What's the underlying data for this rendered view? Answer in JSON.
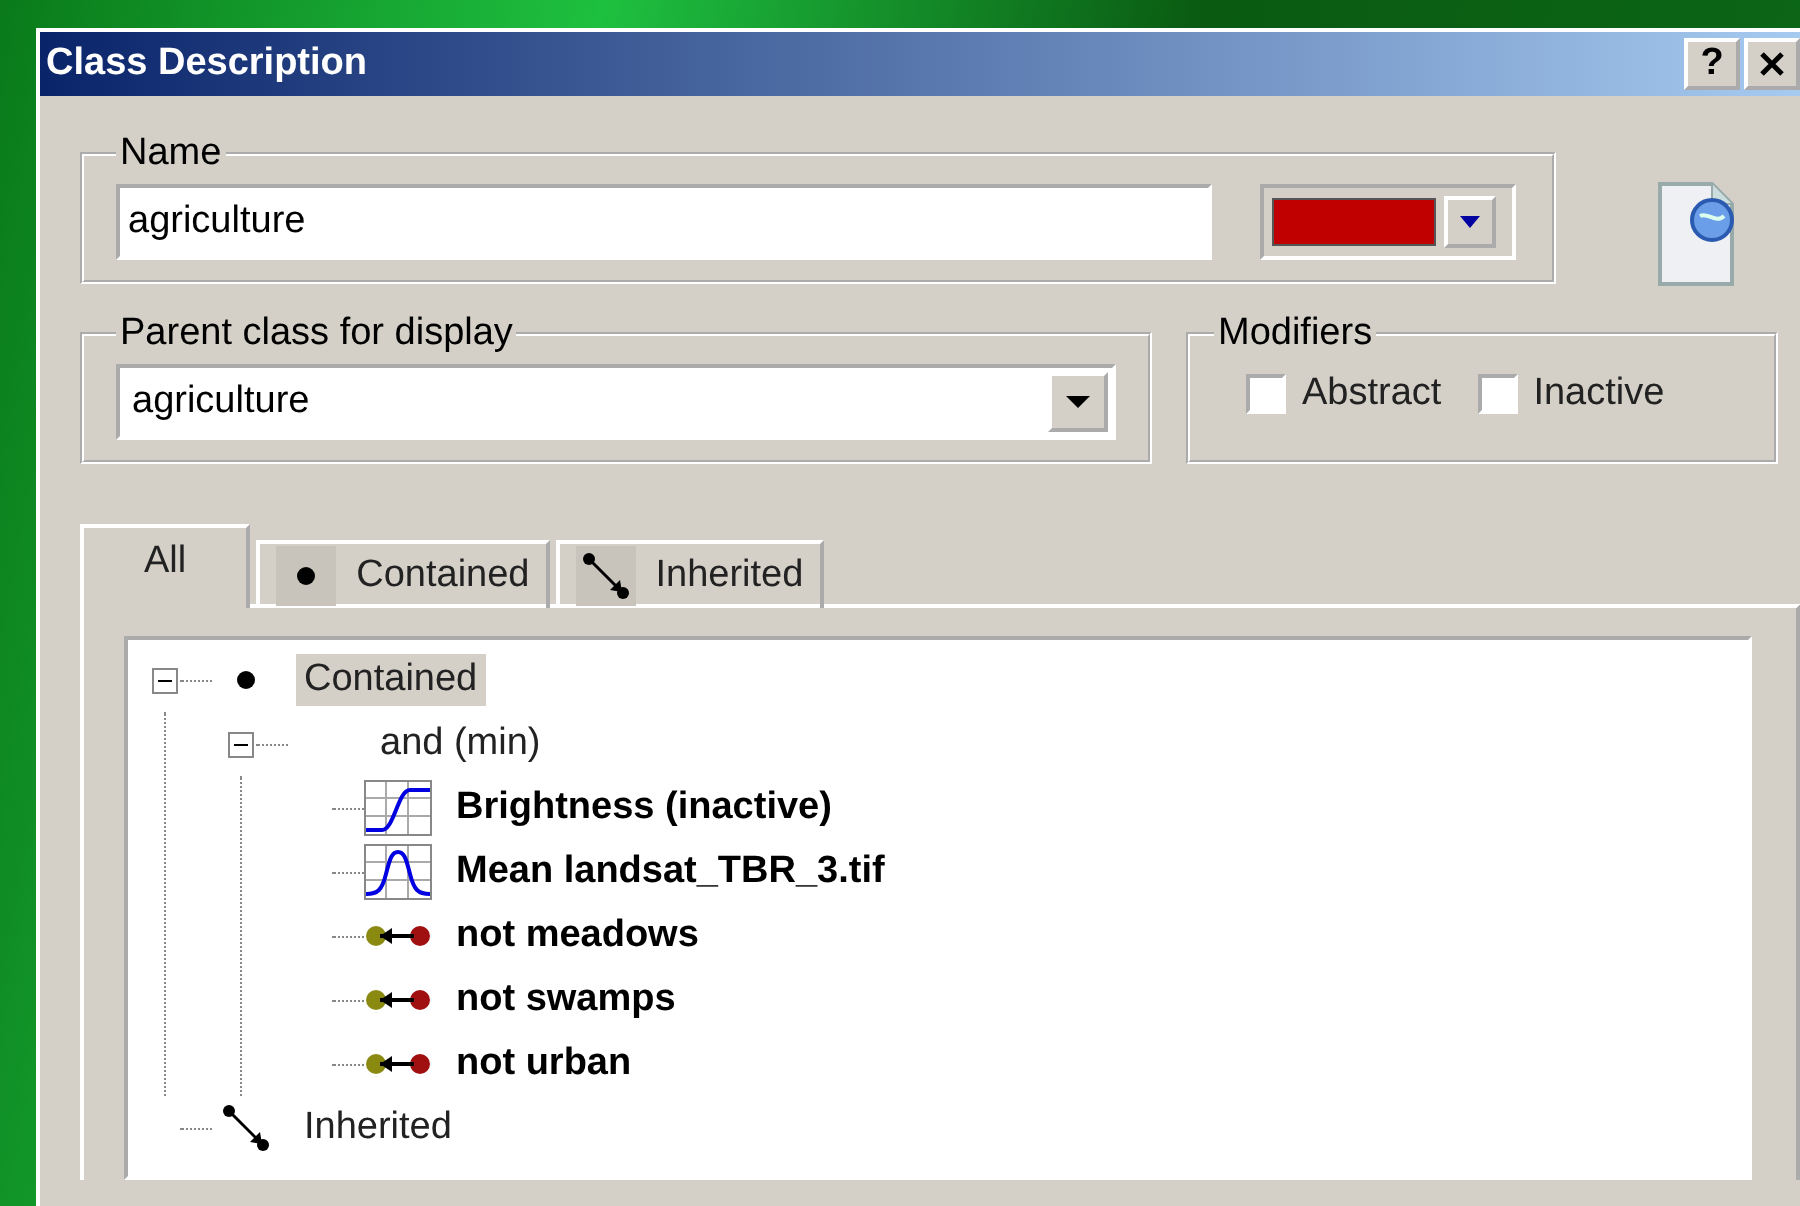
{
  "window": {
    "title": "Class Description",
    "title_buttons": [
      {
        "kind": "help",
        "label": "?"
      },
      {
        "kind": "close"
      }
    ]
  },
  "name_group": {
    "label": "Name",
    "value": "agriculture",
    "color": "#c00000"
  },
  "parent_group": {
    "label": "Parent class for display",
    "value": "agriculture"
  },
  "modifiers": {
    "label": "Modifiers",
    "options": [
      {
        "label": "Abstract",
        "checked": false
      },
      {
        "label": "Inactive",
        "checked": false
      }
    ]
  },
  "tabs": [
    {
      "label": "All",
      "kind": "all",
      "selected": true
    },
    {
      "label": "Contained",
      "kind": "contained",
      "selected": false
    },
    {
      "label": "Inherited",
      "kind": "inherited",
      "selected": false
    }
  ],
  "tree": [
    {
      "label": "Contained",
      "kind": "contained",
      "selected": true,
      "expanded": true,
      "children": [
        {
          "label": "and (min)",
          "kind": "operator",
          "selected": false,
          "expanded": true,
          "children": [
            {
              "label": "Brightness (inactive)",
              "kind": "membership",
              "selected": false
            },
            {
              "label": "Mean landsat_TBR_3.tif",
              "kind": "gaussian",
              "selected": false
            },
            {
              "label": "not meadows",
              "kind": "relation",
              "selected": false
            },
            {
              "label": "not swamps",
              "kind": "relation",
              "selected": false
            },
            {
              "label": "not urban",
              "kind": "relation",
              "selected": false
            }
          ]
        }
      ]
    },
    {
      "label": "Inherited",
      "kind": "inherited",
      "selected": false
    }
  ]
}
